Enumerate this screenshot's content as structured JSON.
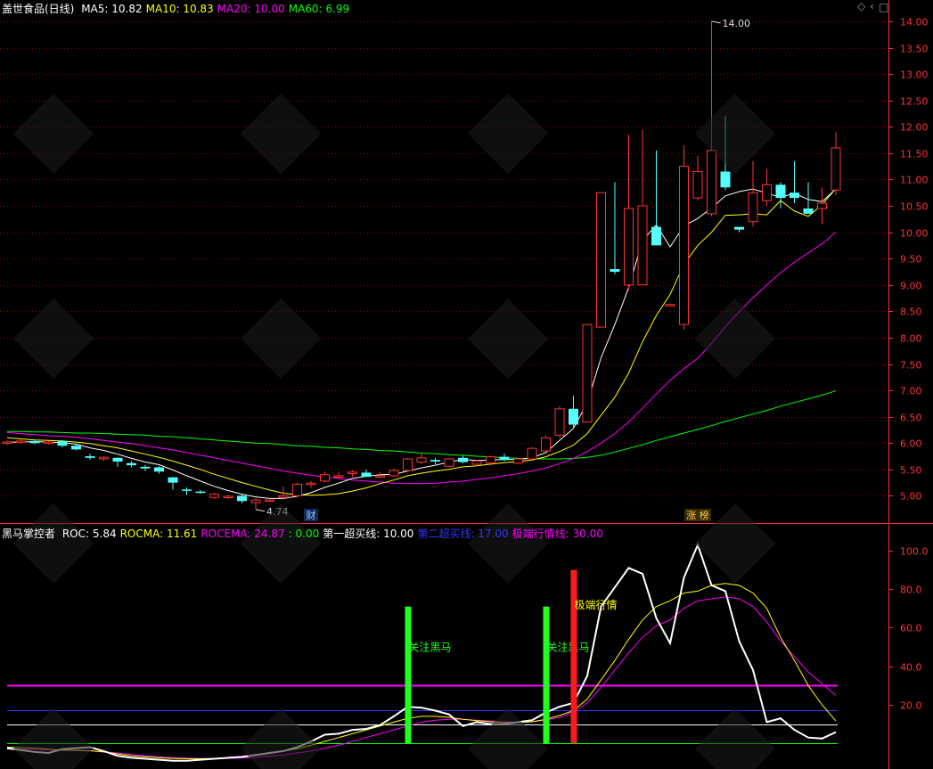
{
  "header": {
    "stock_name": "盖世食品(日线)",
    "ma_items": [
      {
        "label": "MA5: 10.82",
        "color": "#ffffff"
      },
      {
        "label": "MA10: 10.83",
        "color": "#ffff00"
      },
      {
        "label": "MA20: 10.00",
        "color": "#ff00ff"
      },
      {
        "label": "MA60: 6.99",
        "color": "#00ff00"
      }
    ]
  },
  "toolbar_icons": [
    "diamond-icon",
    "chevron-left-icon",
    "square-icon"
  ],
  "indicator_header": {
    "name": "黑马掌控者",
    "items": [
      {
        "label": "ROC: 5.84",
        "color": "#ffffff"
      },
      {
        "label": "ROCMA: 11.61",
        "color": "#ffff00"
      },
      {
        "label": "ROCEMA: 24.87",
        "color": "#ff00ff"
      },
      {
        "label": ": 0.00",
        "color": "#00ff00"
      },
      {
        "label": "第一超买线: 10.00",
        "color": "#ffffff"
      },
      {
        "label": "第二超买线: 17.00",
        "color": "#3333ff"
      },
      {
        "label": "极端行情线: 30.00",
        "color": "#ff00ff"
      }
    ]
  },
  "colors": {
    "up": "#ff3232",
    "down": "#54ffff",
    "grid": "#8b0000",
    "axis": "#ff3232",
    "ma5": "#ffffff",
    "ma10": "#ffff00",
    "ma20": "#ff00ff",
    "ma60": "#00ff00"
  },
  "chart_data": [
    {
      "type": "candlestick",
      "title": "盖世食品(日线)",
      "ylim": [
        4.5,
        14.1
      ],
      "y_ticks": [
        5.0,
        5.5,
        6.0,
        6.5,
        7.0,
        7.5,
        8.0,
        8.5,
        9.0,
        9.5,
        10.0,
        10.5,
        11.0,
        11.5,
        12.0,
        12.5,
        13.0,
        13.5,
        14.0
      ],
      "candles": [
        [
          6.0,
          6.05,
          5.96,
          6.02
        ],
        [
          6.02,
          6.08,
          5.99,
          6.04
        ],
        [
          6.04,
          6.06,
          5.98,
          6.0
        ],
        [
          6.0,
          6.04,
          5.97,
          6.02
        ],
        [
          6.04,
          6.06,
          5.92,
          5.95
        ],
        [
          5.95,
          5.98,
          5.86,
          5.88
        ],
        [
          5.75,
          5.8,
          5.68,
          5.72
        ],
        [
          5.7,
          5.75,
          5.66,
          5.73
        ],
        [
          5.72,
          5.73,
          5.55,
          5.65
        ],
        [
          5.62,
          5.66,
          5.54,
          5.58
        ],
        [
          5.55,
          5.58,
          5.47,
          5.52
        ],
        [
          5.54,
          5.56,
          5.42,
          5.46
        ],
        [
          5.35,
          5.36,
          5.12,
          5.25
        ],
        [
          5.12,
          5.16,
          5.02,
          5.1
        ],
        [
          5.08,
          5.11,
          5.04,
          5.06
        ],
        [
          4.97,
          5.06,
          4.94,
          5.03
        ],
        [
          4.98,
          5.02,
          4.94,
          4.99
        ],
        [
          5.0,
          5.02,
          4.86,
          4.9
        ],
        [
          4.87,
          4.96,
          4.74,
          4.92
        ],
        [
          4.91,
          4.97,
          4.88,
          4.92
        ],
        [
          4.97,
          5.18,
          4.93,
          5.0
        ],
        [
          5.0,
          5.25,
          4.98,
          5.22
        ],
        [
          5.22,
          5.28,
          5.15,
          5.24
        ],
        [
          5.28,
          5.46,
          5.25,
          5.4
        ],
        [
          5.38,
          5.46,
          5.32,
          5.38
        ],
        [
          5.42,
          5.48,
          5.36,
          5.45
        ],
        [
          5.44,
          5.5,
          5.38,
          5.36
        ],
        [
          5.36,
          5.45,
          5.34,
          5.38
        ],
        [
          5.38,
          5.52,
          5.36,
          5.48
        ],
        [
          5.48,
          5.72,
          5.46,
          5.7
        ],
        [
          5.64,
          5.8,
          5.6,
          5.72
        ],
        [
          5.68,
          5.72,
          5.6,
          5.65
        ],
        [
          5.56,
          5.72,
          5.54,
          5.7
        ],
        [
          5.72,
          5.76,
          5.62,
          5.64
        ],
        [
          5.6,
          5.68,
          5.56,
          5.66
        ],
        [
          5.62,
          5.76,
          5.6,
          5.74
        ],
        [
          5.74,
          5.8,
          5.66,
          5.68
        ],
        [
          5.62,
          5.72,
          5.6,
          5.7
        ],
        [
          5.7,
          5.92,
          5.66,
          5.9
        ],
        [
          5.85,
          6.15,
          5.82,
          6.1
        ],
        [
          6.15,
          6.7,
          6.1,
          6.65
        ],
        [
          6.65,
          6.9,
          6.3,
          6.35
        ],
        [
          6.4,
          8.25,
          6.4,
          8.25
        ],
        [
          8.2,
          10.75,
          8.2,
          10.75
        ],
        [
          9.3,
          10.95,
          9.2,
          9.25
        ],
        [
          9.0,
          11.85,
          8.9,
          10.45
        ],
        [
          9.0,
          11.95,
          9.0,
          10.5
        ],
        [
          10.1,
          11.55,
          9.8,
          9.75
        ],
        [
          8.6,
          8.65,
          8.6,
          8.63
        ],
        [
          8.25,
          11.65,
          8.15,
          11.25
        ],
        [
          10.65,
          11.45,
          10.6,
          11.15
        ],
        [
          10.35,
          14.0,
          10.3,
          11.55
        ],
        [
          11.15,
          12.2,
          10.8,
          10.85
        ],
        [
          10.1,
          10.1,
          10.0,
          10.05
        ],
        [
          10.2,
          11.35,
          10.1,
          10.75
        ],
        [
          10.6,
          11.2,
          10.5,
          10.9
        ],
        [
          10.9,
          10.95,
          10.45,
          10.65
        ],
        [
          10.75,
          11.35,
          10.55,
          10.65
        ],
        [
          10.45,
          10.95,
          10.35,
          10.35
        ],
        [
          10.45,
          10.85,
          10.15,
          10.55
        ],
        [
          10.8,
          11.9,
          10.7,
          11.6
        ]
      ],
      "ma5": [
        6.02,
        6.02,
        6.03,
        6.02,
        6.01,
        5.98,
        5.91,
        5.86,
        5.79,
        5.71,
        5.64,
        5.59,
        5.49,
        5.38,
        5.28,
        5.18,
        5.1,
        5.03,
        4.98,
        4.95,
        4.95,
        4.99,
        5.06,
        5.16,
        5.24,
        5.33,
        5.37,
        5.4,
        5.41,
        5.47,
        5.53,
        5.58,
        5.64,
        5.69,
        5.67,
        5.68,
        5.69,
        5.69,
        5.72,
        5.82,
        6.05,
        6.28,
        6.76,
        7.62,
        8.25,
        8.95,
        9.84,
        10.14,
        9.72,
        10.12,
        10.26,
        10.46,
        10.69,
        10.77,
        10.82,
        10.74,
        10.66,
        10.74,
        10.62,
        10.58,
        10.82
      ],
      "ma10": [
        6.1,
        6.08,
        6.06,
        6.05,
        6.04,
        6.02,
        5.99,
        5.95,
        5.91,
        5.85,
        5.79,
        5.73,
        5.66,
        5.58,
        5.5,
        5.41,
        5.33,
        5.25,
        5.18,
        5.11,
        5.05,
        5.02,
        5.01,
        5.02,
        5.04,
        5.09,
        5.15,
        5.23,
        5.3,
        5.38,
        5.43,
        5.47,
        5.5,
        5.55,
        5.57,
        5.6,
        5.63,
        5.65,
        5.68,
        5.74,
        5.84,
        5.96,
        6.18,
        6.53,
        6.87,
        7.33,
        7.92,
        8.42,
        8.82,
        9.39,
        9.75,
        10.0,
        10.32,
        10.33,
        10.35,
        10.33,
        10.6,
        10.4,
        10.3,
        10.52,
        10.83
      ],
      "ma20": [
        6.2,
        6.18,
        6.16,
        6.14,
        6.13,
        6.11,
        6.08,
        6.05,
        6.02,
        5.99,
        5.95,
        5.91,
        5.87,
        5.82,
        5.77,
        5.72,
        5.67,
        5.62,
        5.57,
        5.52,
        5.47,
        5.43,
        5.39,
        5.36,
        5.33,
        5.3,
        5.28,
        5.26,
        5.24,
        5.23,
        5.23,
        5.24,
        5.26,
        5.28,
        5.31,
        5.34,
        5.38,
        5.42,
        5.47,
        5.53,
        5.61,
        5.71,
        5.84,
        6.0,
        6.18,
        6.4,
        6.66,
        6.93,
        7.19,
        7.41,
        7.61,
        7.89,
        8.21,
        8.49,
        8.76,
        9.0,
        9.23,
        9.43,
        9.61,
        9.78,
        10.0
      ],
      "ma60": [
        6.22,
        6.22,
        6.21,
        6.21,
        6.2,
        6.19,
        6.19,
        6.18,
        6.17,
        6.16,
        6.15,
        6.13,
        6.12,
        6.1,
        6.08,
        6.06,
        6.04,
        6.02,
        6.0,
        5.99,
        5.97,
        5.95,
        5.94,
        5.92,
        5.91,
        5.89,
        5.88,
        5.86,
        5.85,
        5.83,
        5.81,
        5.8,
        5.78,
        5.77,
        5.75,
        5.74,
        5.72,
        5.71,
        5.7,
        5.7,
        5.7,
        5.71,
        5.73,
        5.77,
        5.83,
        5.9,
        5.97,
        6.05,
        6.12,
        6.19,
        6.26,
        6.33,
        6.41,
        6.48,
        6.55,
        6.62,
        6.7,
        6.77,
        6.84,
        6.91,
        6.99
      ],
      "annotations": [
        {
          "text": "14.00",
          "index": 51,
          "value": 14.0
        },
        {
          "text": "4.74",
          "index": 18,
          "value": 4.74
        }
      ],
      "bottom_labels": [
        {
          "text": "财",
          "index": 22
        },
        {
          "text": "涨 榜",
          "index": 50
        }
      ]
    },
    {
      "type": "line",
      "title": "黑马掌控者",
      "ylim": [
        -11,
        106
      ],
      "y_ticks": [
        20.0,
        40.0,
        60.0,
        80.0,
        100.0
      ],
      "series": [
        {
          "name": "ROC",
          "color": "#ffffff",
          "values": [
            -2.5,
            -3.5,
            -4.5,
            -5.0,
            -3.0,
            -2.5,
            -2.0,
            -4.0,
            -6.5,
            -7.5,
            -8.0,
            -8.5,
            -9.0,
            -9.0,
            -8.5,
            -8.0,
            -7.5,
            -7.0,
            -6.0,
            -5.0,
            -4.0,
            -2.0,
            1.0,
            4.5,
            5.0,
            7.0,
            7.5,
            9.5,
            14.0,
            19.0,
            18.5,
            17.0,
            15.0,
            9.0,
            11.0,
            10.0,
            10.0,
            11.0,
            12.0,
            16.0,
            19.0,
            21.0,
            35.0,
            71.0,
            81.0,
            91.0,
            88.0,
            65.0,
            52.0,
            86.0,
            103.0,
            82.0,
            79.0,
            53.0,
            38.0,
            11.0,
            13.0,
            7.0,
            3.0,
            2.5,
            5.84
          ]
        },
        {
          "name": "ROCMA",
          "color": "#ffff00",
          "values": [
            -2.0,
            -2.2,
            -2.5,
            -3.0,
            -3.5,
            -3.6,
            -3.8,
            -4.5,
            -5.5,
            -6.5,
            -7.0,
            -7.5,
            -7.8,
            -8.0,
            -8.0,
            -7.8,
            -7.5,
            -7.0,
            -6.2,
            -5.2,
            -4.0,
            -2.8,
            -1.0,
            1.0,
            3.0,
            5.0,
            7.0,
            9.0,
            11.0,
            13.0,
            14.0,
            14.0,
            13.5,
            12.5,
            11.8,
            11.2,
            10.8,
            10.8,
            11.2,
            12.5,
            14.5,
            17.0,
            23.0,
            33.0,
            43.0,
            54.0,
            64.0,
            71.0,
            74.0,
            78.0,
            79.0,
            82.0,
            83.0,
            82.0,
            78.0,
            70.0,
            55.0,
            43.0,
            30.0,
            20.0,
            11.61
          ]
        },
        {
          "name": "ROCEMA",
          "color": "#ff00ff",
          "values": [
            -3.0,
            -3.0,
            -3.2,
            -3.4,
            -3.6,
            -3.8,
            -4.0,
            -4.4,
            -5.0,
            -5.8,
            -6.4,
            -7.0,
            -7.4,
            -7.7,
            -7.9,
            -7.9,
            -7.8,
            -7.6,
            -7.2,
            -6.6,
            -6.0,
            -5.0,
            -4.0,
            -2.5,
            -1.0,
            1.0,
            3.0,
            5.0,
            7.0,
            9.0,
            11.0,
            12.0,
            12.5,
            12.5,
            12.0,
            11.6,
            11.2,
            11.0,
            11.2,
            12.0,
            13.5,
            16.0,
            21.0,
            29.0,
            38.0,
            47.0,
            55.0,
            61.0,
            64.0,
            70.0,
            74.0,
            75.0,
            76.0,
            75.0,
            71.0,
            63.0,
            53.0,
            45.0,
            37.0,
            31.0,
            24.87
          ]
        }
      ],
      "hlines": [
        {
          "value": 0,
          "color": "#00ff00"
        },
        {
          "value": 10,
          "color": "#ffffff"
        },
        {
          "value": 17,
          "color": "#3333ff"
        },
        {
          "value": 30,
          "color": "#ff00ff"
        }
      ],
      "bars": [
        {
          "index": 29,
          "top": 71,
          "color": "#22ff22",
          "label": "关注黑马"
        },
        {
          "index": 39,
          "top": 71,
          "color": "#22ff22",
          "label": "关注黑马"
        },
        {
          "index": 41,
          "top": 90,
          "color": "#ff1a1a",
          "label": "极端行情"
        }
      ]
    }
  ]
}
